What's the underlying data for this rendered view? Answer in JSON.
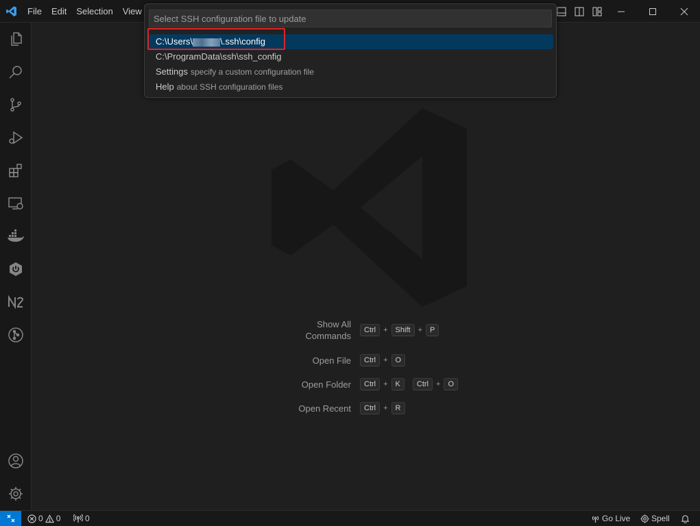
{
  "menu": [
    "File",
    "Edit",
    "Selection",
    "View"
  ],
  "quick_pick": {
    "placeholder": "Select SSH configuration file to update",
    "items": [
      {
        "label_prefix": "C:\\Users\\",
        "label_suffix": "\\.ssh\\config",
        "description": ""
      },
      {
        "label": "C:\\ProgramData\\ssh\\ssh_config",
        "description": ""
      },
      {
        "label": "Settings",
        "description": "specify a custom configuration file"
      },
      {
        "label": "Help",
        "description": "about SSH configuration files"
      }
    ]
  },
  "shortcuts": [
    {
      "label_line1": "Show All",
      "label_line2": "Commands",
      "keys": [
        "Ctrl",
        "Shift",
        "P"
      ]
    },
    {
      "label": "Open File",
      "keys": [
        "Ctrl",
        "O"
      ]
    },
    {
      "label": "Open Folder",
      "keys": [
        "Ctrl",
        "K",
        "Ctrl",
        "O"
      ]
    },
    {
      "label": "Open Recent",
      "keys": [
        "Ctrl",
        "R"
      ]
    }
  ],
  "statusbar": {
    "errors": "0",
    "warnings": "0",
    "ports": "0",
    "go_live": "Go Live",
    "spell": "Spell"
  },
  "colors": {
    "accent": "#0078d4",
    "selection": "#04395e",
    "highlight_box": "#e02424"
  }
}
